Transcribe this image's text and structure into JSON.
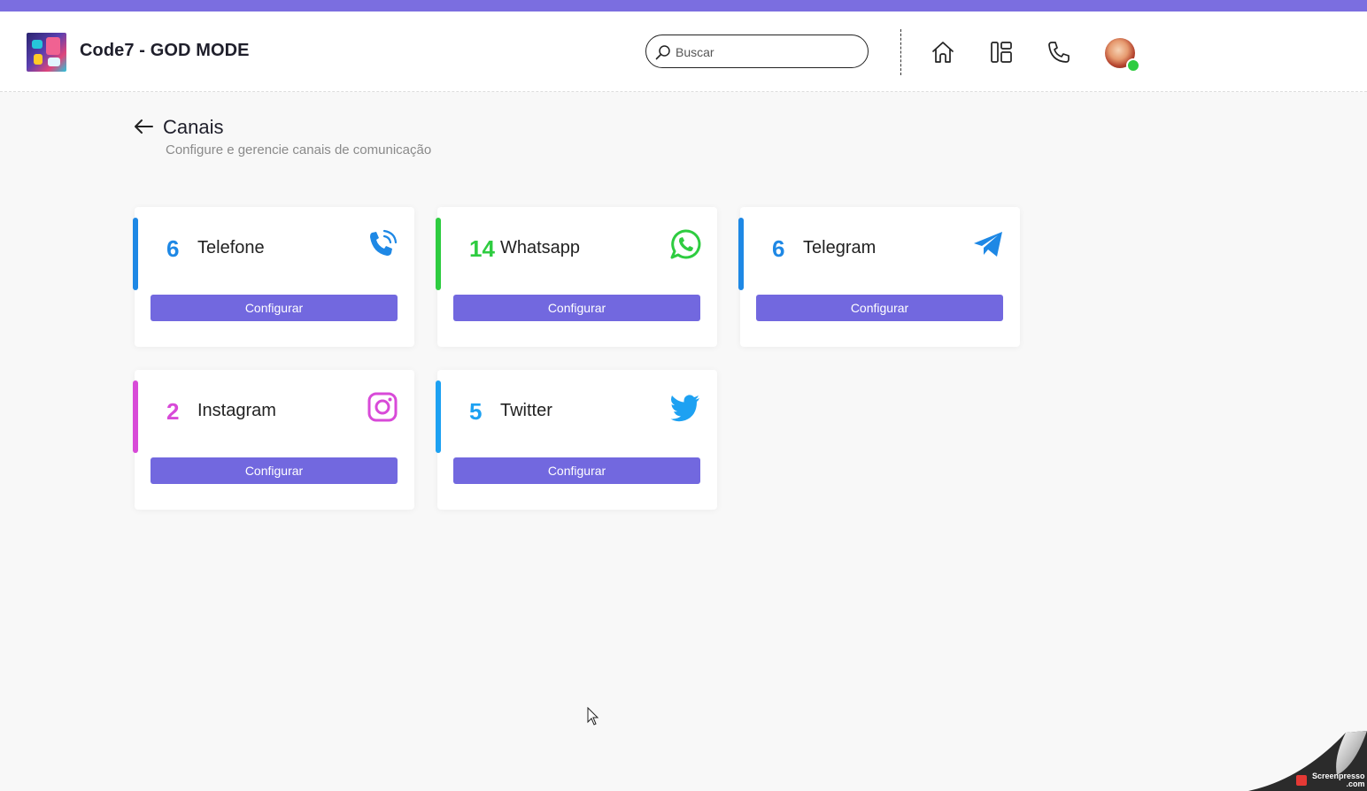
{
  "header": {
    "brand": "Code7 - GOD MODE",
    "search_placeholder": "Buscar",
    "accent_color": "#7b6ee0",
    "icons": [
      "home-icon",
      "layout-icon",
      "phone-icon"
    ]
  },
  "page": {
    "title": "Canais",
    "subtitle": "Configure e gerencie canais de comunicação"
  },
  "channels": [
    {
      "count": "6",
      "name": "Telefone",
      "icon": "phone-ringing-icon",
      "color": "#1e88e5",
      "button": "Configurar"
    },
    {
      "count": "14",
      "name": "Whatsapp",
      "icon": "whatsapp-icon",
      "color": "#2ecc40",
      "button": "Configurar"
    },
    {
      "count": "6",
      "name": "Telegram",
      "icon": "telegram-icon",
      "color": "#1e88e5",
      "button": "Configurar"
    },
    {
      "count": "2",
      "name": "Instagram",
      "icon": "instagram-icon",
      "color": "#d84ad8",
      "button": "Configurar"
    },
    {
      "count": "5",
      "name": "Twitter",
      "icon": "twitter-icon",
      "color": "#1da1f2",
      "button": "Configurar"
    }
  ],
  "watermark": {
    "line1": "Screenpresso",
    "line2": ".com"
  }
}
